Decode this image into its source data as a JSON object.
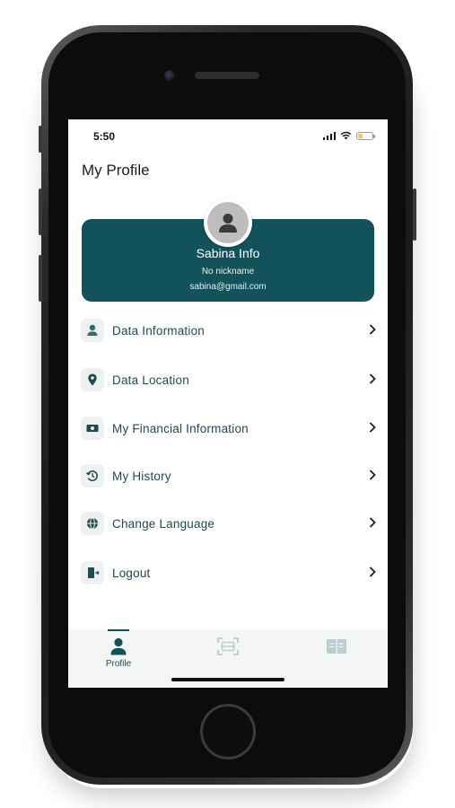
{
  "status_bar": {
    "time": "5:50"
  },
  "page": {
    "title": "My Profile"
  },
  "profile": {
    "name": "Sabina Info",
    "nickname": "No nickname",
    "email": "sabina@gmail.com"
  },
  "menu": [
    {
      "label": "Data Information",
      "icon": "user-card-icon"
    },
    {
      "label": "Data Location",
      "icon": "location-pin-icon"
    },
    {
      "label": "My Financial Information",
      "icon": "money-icon"
    },
    {
      "label": "My History",
      "icon": "history-icon"
    },
    {
      "label": "Change Language",
      "icon": "globe-icon"
    },
    {
      "label": "Logout",
      "icon": "logout-door-icon"
    }
  ],
  "bottom_nav": {
    "items": [
      {
        "label": "Profile",
        "icon": "person-icon",
        "active": true
      },
      {
        "label": "",
        "icon": "scan-icon",
        "active": false
      },
      {
        "label": "",
        "icon": "book-icon",
        "active": false
      }
    ]
  },
  "colors": {
    "accent": "#12525a",
    "text": "#1f4a50",
    "icon_bg": "#eef1f2",
    "nav_bg": "#f4f5f5"
  }
}
